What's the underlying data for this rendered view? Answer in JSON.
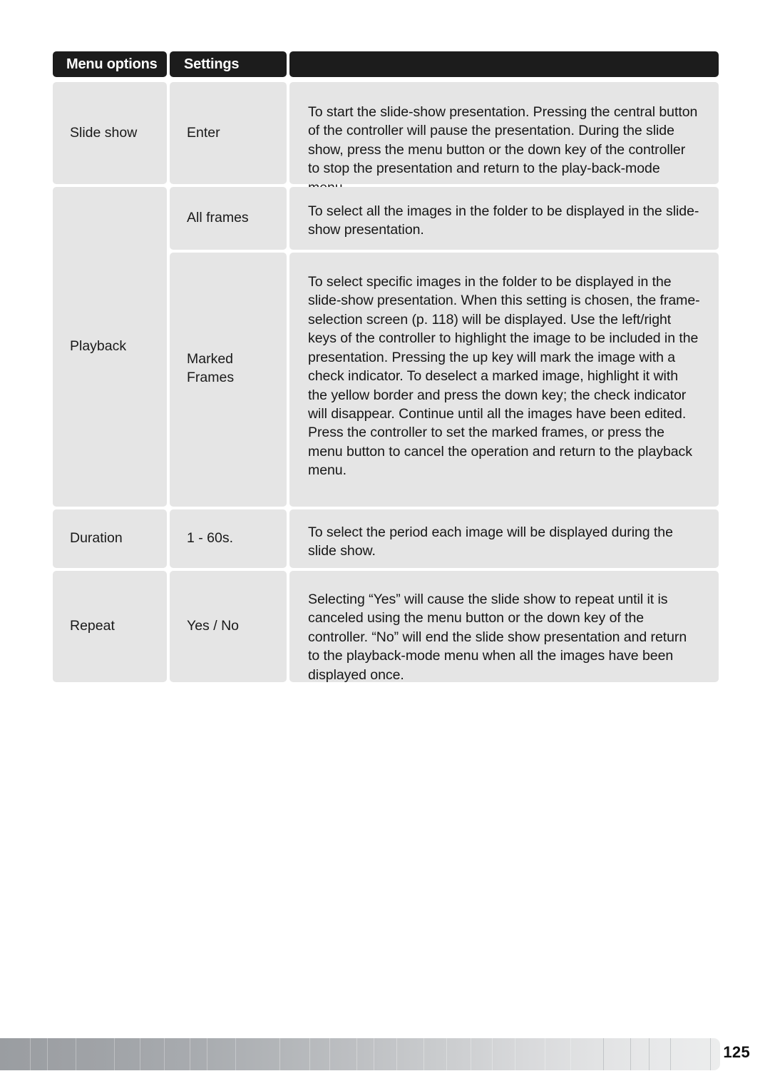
{
  "page": {
    "number": "125"
  },
  "table": {
    "headers": [
      {
        "label": "Menu options"
      },
      {
        "label": "Settings"
      },
      {
        "label": ""
      }
    ],
    "rows": [
      {
        "menu_option": "Slide show",
        "setting": "Enter",
        "description": "To start the slide-show presentation. Pressing the central button of the controller will pause the presentation. During the slide show, press the menu button or the down key of the controller to stop the presentation and return to the play-back-mode menu."
      },
      {
        "menu_option": "Playback",
        "setting": "All frames",
        "description": "To select all the images in the folder to be displayed in the slide-show presentation."
      },
      {
        "menu_option": "",
        "setting": "Marked Frames",
        "setting_line1": "Marked",
        "setting_line2": "Frames",
        "description": "To select specific images in the folder to be displayed in the slide-show presentation. When this setting is chosen, the frame-selection screen (p. 118) will be displayed. Use the left/right keys of the controller to highlight the image to be included in the presentation. Pressing the up key will mark the image with a check indicator. To deselect a marked image, highlight it with the yellow border and press the down key; the check indicator will disappear. Continue until all the images have been edited. Press the controller to set the marked frames, or press the menu button to cancel the operation and return to the playback menu."
      },
      {
        "menu_option": "Duration",
        "setting": "1 - 60s.",
        "description": "To select the period each image will be displayed during the slide show."
      },
      {
        "menu_option": "Repeat",
        "setting": "Yes / No",
        "description": "Selecting “Yes” will cause the slide show to repeat until it is canceled using the menu button or the down key of the controller. “No” will end the slide show presentation and return to the playback-mode menu when all the images have been displayed once."
      }
    ]
  },
  "colors": {
    "header_background": "#1c1c1c",
    "header_text": "#ffffff",
    "cell_background": "#e5e5e5",
    "body_text": "#161616",
    "page_background": "#ffffff"
  }
}
